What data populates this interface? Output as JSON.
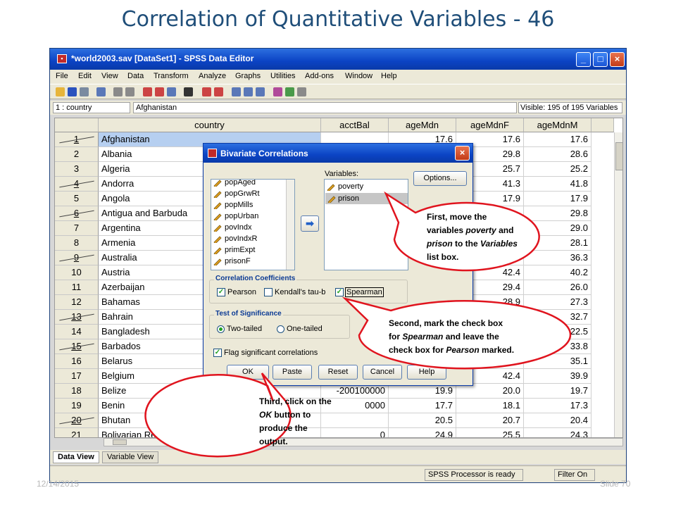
{
  "slide": {
    "title": "Correlation of Quantitative Variables - 46",
    "date": "12/14/2015",
    "slide_number": "Slide 70"
  },
  "window": {
    "title": "*world2003.sav [DataSet1] - SPSS Data Editor",
    "min": "_",
    "max": "□",
    "close": "×"
  },
  "menu": [
    "File",
    "Edit",
    "View",
    "Data",
    "Transform",
    "Analyze",
    "Graphs",
    "Utilities",
    "Add-ons",
    "Window",
    "Help"
  ],
  "cellbar": {
    "reference": "1 : country",
    "value": "Afghanistan",
    "visible": "Visible: 195 of 195 Variables"
  },
  "grid": {
    "columns": [
      "country",
      "acctBal",
      "ageMdn",
      "ageMdnF",
      "ageMdnM"
    ],
    "rows": [
      {
        "n": "1",
        "country": "Afghanistan",
        "acctBal": "",
        "ageMdn": "17.6",
        "ageMdnF": "17.6",
        "ageMdnM": "17.6"
      },
      {
        "n": "2",
        "country": "Albania",
        "acctBal": "",
        "ageMdn": "",
        "ageMdnF": "29.8",
        "ageMdnM": "28.6"
      },
      {
        "n": "3",
        "country": "Algeria",
        "acctBal": "",
        "ageMdn": "",
        "ageMdnF": "25.7",
        "ageMdnM": "25.2"
      },
      {
        "n": "4",
        "country": "Andorra",
        "acctBal": "",
        "ageMdn": "",
        "ageMdnF": "41.3",
        "ageMdnM": "41.8"
      },
      {
        "n": "5",
        "country": "Angola",
        "acctBal": "",
        "ageMdn": "",
        "ageMdnF": "17.9",
        "ageMdnM": "17.9"
      },
      {
        "n": "6",
        "country": "Antigua and Barbuda",
        "acctBal": "",
        "ageMdn": "",
        "ageMdnF": "",
        "ageMdnM": "29.8"
      },
      {
        "n": "7",
        "country": "Argentina",
        "acctBal": "",
        "ageMdn": "",
        "ageMdnF": "",
        "ageMdnM": "29.0"
      },
      {
        "n": "8",
        "country": "Armenia",
        "acctBal": "",
        "ageMdn": "",
        "ageMdnF": "",
        "ageMdnM": "28.1"
      },
      {
        "n": "9",
        "country": "Australia",
        "acctBal": "",
        "ageMdn": "",
        "ageMdnF": "",
        "ageMdnM": "36.3"
      },
      {
        "n": "10",
        "country": "Austria",
        "acctBal": "",
        "ageMdn": "",
        "ageMdnF": "42.4",
        "ageMdnM": "40.2"
      },
      {
        "n": "11",
        "country": "Azerbaijan",
        "acctBal": "",
        "ageMdn": "",
        "ageMdnF": "29.4",
        "ageMdnM": "26.0"
      },
      {
        "n": "12",
        "country": "Bahamas",
        "acctBal": "",
        "ageMdn": "",
        "ageMdnF": "28.9",
        "ageMdnM": "27.3"
      },
      {
        "n": "13",
        "country": "Bahrain",
        "acctBal": "",
        "ageMdn": "",
        "ageMdnF": "",
        "ageMdnM": "32.7"
      },
      {
        "n": "14",
        "country": "Bangladesh",
        "acctBal": "",
        "ageMdn": "",
        "ageMdnF": "",
        "ageMdnM": "22.5"
      },
      {
        "n": "15",
        "country": "Barbados",
        "acctBal": "",
        "ageMdn": "",
        "ageMdnF": "",
        "ageMdnM": "33.8"
      },
      {
        "n": "16",
        "country": "Belarus",
        "acctBal": "",
        "ageMdn": "",
        "ageMdnF": "",
        "ageMdnM": "35.1"
      },
      {
        "n": "17",
        "country": "Belgium",
        "acctBal": "",
        "ageMdn": "",
        "ageMdnF": "42.4",
        "ageMdnM": "39.9"
      },
      {
        "n": "18",
        "country": "Belize",
        "acctBal": "-200100000",
        "ageMdn": "19.9",
        "ageMdnF": "20.0",
        "ageMdnM": "19.7"
      },
      {
        "n": "19",
        "country": "Benin",
        "acctBal": "0000",
        "ageMdn": "17.7",
        "ageMdnF": "18.1",
        "ageMdnM": "17.3"
      },
      {
        "n": "20",
        "country": "Bhutan",
        "acctBal": "",
        "ageMdn": "20.5",
        "ageMdnF": "20.7",
        "ageMdnM": "20.4"
      },
      {
        "n": "21",
        "country": "Bolivarian Republic of Venezuela",
        "acctBal": "0",
        "ageMdn": "24.9",
        "ageMdnF": "25.5",
        "ageMdnM": "24.3"
      }
    ]
  },
  "tabs": {
    "data_view": "Data View",
    "variable_view": "Variable View"
  },
  "status": {
    "processor": "SPSS  Processor is ready",
    "filter": "Filter On"
  },
  "dialog": {
    "title": "Bivariate Correlations",
    "source_items": [
      "popAged",
      "popGrwRt",
      "popMills",
      "popUrban",
      "povIndx",
      "povIndxR",
      "primExpt",
      "prisonF"
    ],
    "variables_label": "Variables:",
    "variables": [
      "poverty",
      "prison"
    ],
    "options_button": "Options...",
    "coeff_group": "Correlation Coefficients",
    "pearson": "Pearson",
    "kendall": "Kendall's tau-b",
    "spearman": "Spearman",
    "sig_group": "Test of Significance",
    "two_tailed": "Two-tailed",
    "one_tailed": "One-tailed",
    "flag": "Flag significant correlations",
    "buttons": {
      "ok": "OK",
      "paste": "Paste",
      "reset": "Reset",
      "cancel": "Cancel",
      "help": "Help"
    },
    "move_arrow": "➡"
  },
  "callouts": {
    "first": {
      "l1": "First, move the",
      "l2a": "variables ",
      "l2b": "poverty",
      "l2c": " and",
      "l3a": "prison",
      "l3b": " to the ",
      "l3c": "Variables",
      "l4": "list box."
    },
    "second": {
      "l1": "Second, mark the check box",
      "l2a": "for ",
      "l2b": "Spearman",
      "l2c": " and leave the",
      "l3a": "check box for ",
      "l3b": "Pearson",
      "l3c": " marked."
    },
    "third": {
      "l1": "Third, click on the",
      "l2a": "OK",
      "l2b": " button to",
      "l3": "produce the",
      "l4": "output."
    }
  },
  "colors": {
    "callout_fill": "#ffffff",
    "callout_stroke": "#e0141e",
    "title": "#1f4e79",
    "selection": "#b6cff0"
  }
}
